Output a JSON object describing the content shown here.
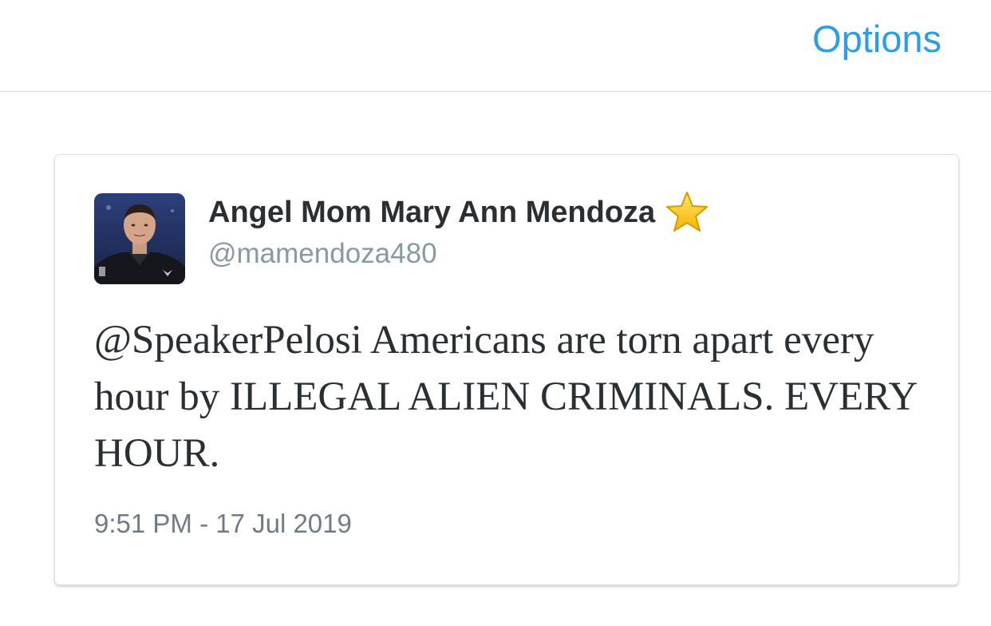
{
  "header": {
    "options_label": "Options",
    "options_color": "#2f9de4"
  },
  "tweet": {
    "author_name": "Angel Mom Mary Ann Mendoza",
    "author_handle": "@mamendoza480",
    "badge_icon": "star-icon",
    "avatar_icon": "profile-photo",
    "text": "@SpeakerPelosi Americans are torn apart every hour by ILLEGAL ALIEN CRIMINALS. EVERY HOUR.",
    "timestamp": "9:51 PM - 17 Jul 2019"
  }
}
